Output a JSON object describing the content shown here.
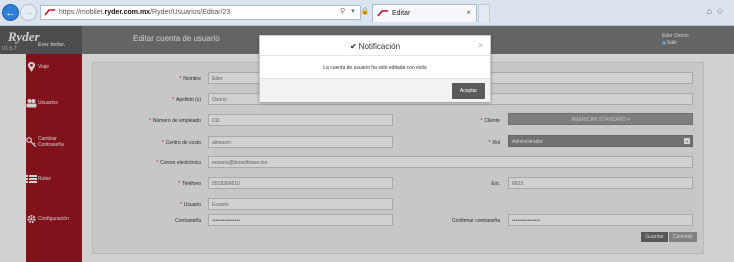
{
  "browser": {
    "url_prefix": "https://mobilet.",
    "url_host": "ryder.com.mx",
    "url_path": "/Ryder/Usuarios/Editar/23",
    "tab_title": "Editar",
    "address_icons": "⚲ ▾ 🔒 ↻"
  },
  "header": {
    "logo": "Ryder",
    "logo_sub": "Ever better.",
    "version": "V1.5.7",
    "page_title": "Editar cuenta de usuario",
    "user_name": "Eder Osorio",
    "logout_label": "Salir"
  },
  "sidebar": {
    "items": [
      {
        "label": "Viaje"
      },
      {
        "label": "Usuarios"
      },
      {
        "label": "Cambiar Contraseña"
      },
      {
        "label": "Roles"
      },
      {
        "label": "Configuración"
      }
    ]
  },
  "form": {
    "required_mark": "*",
    "nombre": {
      "label": "Nombre",
      "value": "Eder"
    },
    "apellidos": {
      "label": "Apellido (s)",
      "value": "Osorio"
    },
    "empleado": {
      "label": "Número de empleado",
      "value": "011"
    },
    "cliente": {
      "label": "Cliente",
      "value": "AMERICAN STANDARD ▾"
    },
    "centro": {
      "label": "Centro de costo",
      "value": "almacen"
    },
    "rol": {
      "label": "Rol",
      "value": "Administrador"
    },
    "correo": {
      "label": "Correo electrónico",
      "value": "eosorio@biosoftware.mx"
    },
    "telefono": {
      "label": "Teléfono",
      "value": "5518269610"
    },
    "ext": {
      "label": "Ext.",
      "value": "6623"
    },
    "usuario": {
      "label": "Usuario",
      "value": "Eosorio"
    },
    "contrasena": {
      "label": "Contraseña",
      "value": "••••••••••••••••"
    },
    "confirmar": {
      "label": "Confirmar contraseña",
      "value": "••••••••••••••••"
    },
    "save_label": "Guardar",
    "cancel_label": "Cancelar"
  },
  "modal": {
    "title_icon": "✔",
    "title": "Notificación",
    "close": "×",
    "message": "La cuenta de usuario ha sido editada con éxito",
    "ok_label": "Aceptar"
  }
}
